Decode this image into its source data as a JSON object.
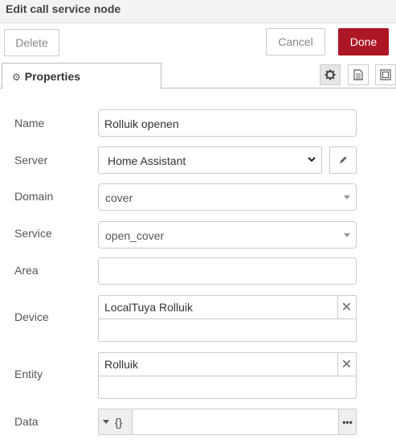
{
  "dialog": {
    "title": "Edit call service node"
  },
  "toolbar": {
    "delete_label": "Delete",
    "cancel_label": "Cancel",
    "done_label": "Done",
    "done_color": "#ad1625"
  },
  "tabs": {
    "properties_label": "Properties",
    "icons": [
      "gear-icon",
      "description-icon",
      "appearance-icon"
    ]
  },
  "form": {
    "name": {
      "label": "Name",
      "value": "Rolluik openen"
    },
    "server": {
      "label": "Server",
      "value": "Home Assistant"
    },
    "domain": {
      "label": "Domain",
      "value": "cover"
    },
    "service": {
      "label": "Service",
      "value": "open_cover"
    },
    "area": {
      "label": "Area",
      "value": ""
    },
    "device": {
      "label": "Device",
      "value": "LocalTuya Rolluik"
    },
    "entity": {
      "label": "Entity",
      "value": "Rolluik"
    },
    "data": {
      "label": "Data",
      "type_label": "{}",
      "value": ""
    }
  }
}
